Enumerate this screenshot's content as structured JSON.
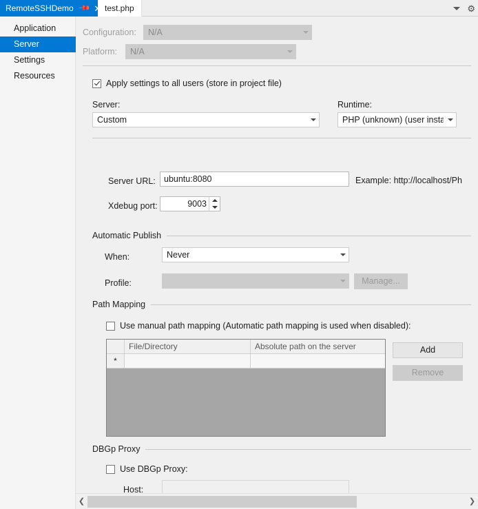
{
  "window": {
    "tabs": [
      {
        "title": "RemoteSSHDemo",
        "active": true,
        "pin_icon": "pin-icon",
        "close_icon": "close-icon"
      },
      {
        "title": "test.php",
        "active": false
      }
    ],
    "tabstrip_icons": {
      "chevron": "chevron-down-icon",
      "gear": "gear-icon"
    }
  },
  "sidebar": {
    "items": [
      {
        "label": "Application",
        "selected": false
      },
      {
        "label": "Server",
        "selected": true
      },
      {
        "label": "Settings",
        "selected": false
      },
      {
        "label": "Resources",
        "selected": false
      }
    ]
  },
  "header": {
    "configuration": {
      "label": "Configuration:",
      "value": "N/A",
      "disabled": true
    },
    "platform": {
      "label": "Platform:",
      "value": "N/A",
      "disabled": true
    }
  },
  "apply_all_users": {
    "label": "Apply settings to all users (store in project file)",
    "checked": true
  },
  "server_section": {
    "server": {
      "label": "Server:",
      "value": "Custom"
    },
    "runtime": {
      "label": "Runtime:",
      "value": "PHP  (unknown) (user instal"
    },
    "server_url": {
      "label": "Server URL:",
      "value": "ubuntu:8080"
    },
    "server_url_example": "Example: http://localhost/Ph",
    "xdebug_port": {
      "label": "Xdebug port:",
      "value": "9003"
    }
  },
  "automatic_publish": {
    "title": "Automatic Publish",
    "when": {
      "label": "When:",
      "value": "Never"
    },
    "profile": {
      "label": "Profile:",
      "value": "",
      "disabled": true
    },
    "manage_button": {
      "label": "Manage...",
      "disabled": true
    }
  },
  "path_mapping": {
    "title": "Path Mapping",
    "use_manual": {
      "label": "Use manual path mapping (Automatic path mapping is used when disabled):",
      "checked": false
    },
    "grid": {
      "columns": [
        "",
        "File/Directory",
        "Absolute path on the server"
      ],
      "rows": [
        {
          "marker": "*",
          "file_directory": "",
          "absolute_path": ""
        }
      ]
    },
    "add_button": {
      "label": "Add",
      "disabled": false
    },
    "remove_button": {
      "label": "Remove",
      "disabled": true
    }
  },
  "dbgp_proxy": {
    "title": "DBGp Proxy",
    "use_proxy": {
      "label": "Use DBGp Proxy:",
      "checked": false
    },
    "host": {
      "label": "Host:",
      "value": "",
      "disabled": true
    }
  },
  "scrollbar": {
    "left_arrow": "chevron-left-icon",
    "right_arrow": "chevron-right-icon"
  },
  "colors": {
    "accent": "#0078d4",
    "content_bg": "#f0f0f0",
    "sidebar_bg": "#f5f5f5",
    "disabled_bg": "#cccccc"
  }
}
